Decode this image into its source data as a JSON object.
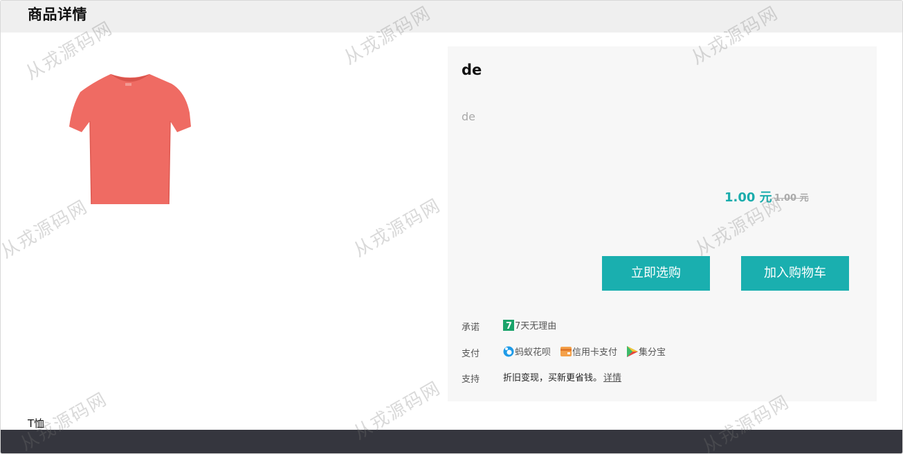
{
  "header": {
    "title": "商品详情"
  },
  "product": {
    "image_icon": "tshirt-image",
    "name": "de",
    "description": "de",
    "price": "1.00 元",
    "original_price": "1.00 元",
    "caption": "T恤"
  },
  "actions": {
    "buy_now": "立即选购",
    "add_to_cart": "加入购物车"
  },
  "promise": {
    "label": "承诺",
    "item": "7天无理由",
    "icon": "seven-day-icon"
  },
  "payment": {
    "label": "支付",
    "methods": [
      {
        "name": "蚂蚁花呗",
        "icon": "huabei-icon"
      },
      {
        "name": "信用卡支付",
        "icon": "credit-card-icon"
      },
      {
        "name": "集分宝",
        "icon": "jifenbao-icon"
      }
    ]
  },
  "support": {
    "label": "支持",
    "text": "折旧变现，买新更省钱。",
    "link": "详情"
  },
  "watermark": {
    "text": "从戎源码网"
  },
  "colors": {
    "accent": "#1aafaf",
    "price": "#1aacac",
    "panel_bg": "#f7f7f7",
    "header_bg": "#efefef",
    "footer_bg": "#35363e",
    "shirt": "#ef6b63"
  }
}
